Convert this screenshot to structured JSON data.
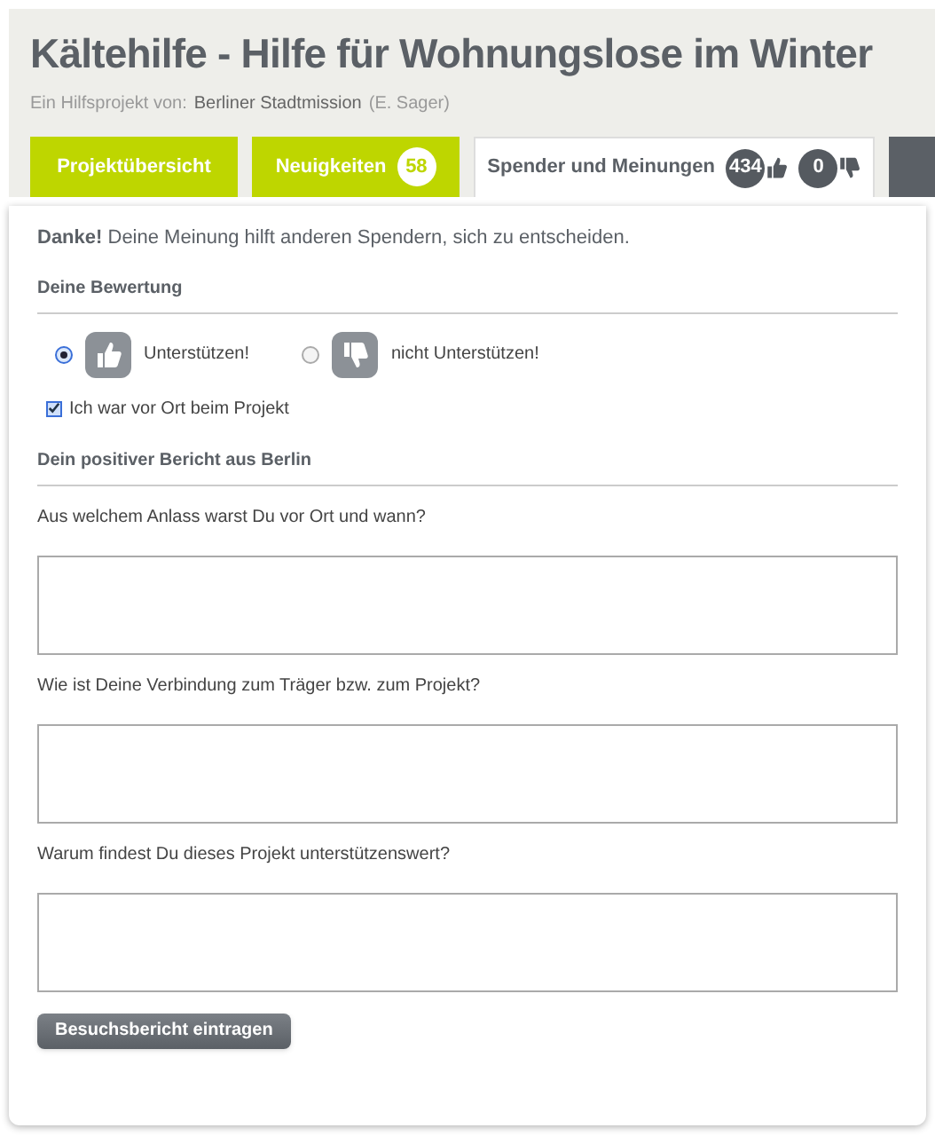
{
  "header": {
    "title": "Kältehilfe - Hilfe für Wohnungslose im Winter",
    "subtitle_prefix": "Ein Hilfsprojekt von:",
    "organization": "Berliner Stadtmission",
    "person": "(E. Sager)"
  },
  "tabs": [
    {
      "label": "Projektübersicht",
      "selected": false
    },
    {
      "label": "Neuigkeiten",
      "selected": false,
      "badges": [
        {
          "kind": "plain",
          "text": "58"
        }
      ]
    },
    {
      "label": "Spender und Meinungen",
      "selected": true,
      "badges": [
        {
          "kind": "up",
          "text": "434"
        },
        {
          "kind": "down",
          "text": "0"
        }
      ]
    }
  ],
  "thanks": "**Danke!** Deine Meinung hilft anderen Spendern, sich zu entscheiden.",
  "rating": {
    "heading": "Deine Bewertung",
    "options": [
      {
        "kind": "up",
        "label": "Unterstützen!",
        "selected": true
      },
      {
        "kind": "down",
        "label": "nicht Unterstützen!",
        "selected": false
      }
    ]
  },
  "visited": {
    "label": "Ich war vor Ort beim Projekt",
    "checked": true
  },
  "report": {
    "heading": "Dein positiver Bericht aus Berlin",
    "questions": [
      "Aus welchem Anlass warst Du vor Ort und wann?",
      "Wie ist Deine Verbindung zum Träger bzw. zum Projekt?",
      "Warum findest Du dieses Projekt unterstützenswert?"
    ]
  },
  "submit": "Besuchsbericht eintragen"
}
